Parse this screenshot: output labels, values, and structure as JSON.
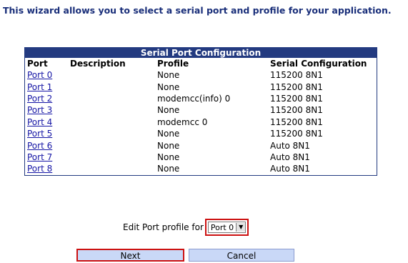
{
  "intro": "This wizard allows you to select a serial port and profile for your application.",
  "table": {
    "caption": "Serial Port Configuration",
    "headers": [
      "Port",
      "Description",
      "Profile",
      "Serial Configuration"
    ],
    "rows": [
      {
        "port": "Port 0",
        "description": "",
        "profile": "None",
        "serial": "115200 8N1"
      },
      {
        "port": "Port 1",
        "description": "",
        "profile": "None",
        "serial": "115200 8N1"
      },
      {
        "port": "Port 2",
        "description": "",
        "profile": "modemcc(info) 0",
        "serial": "115200 8N1"
      },
      {
        "port": "Port 3",
        "description": "",
        "profile": "None",
        "serial": "115200 8N1"
      },
      {
        "port": "Port 4",
        "description": "",
        "profile": "modemcc 0",
        "serial": "115200 8N1"
      },
      {
        "port": "Port 5",
        "description": "",
        "profile": "None",
        "serial": "115200 8N1"
      },
      {
        "port": "Port 6",
        "description": "",
        "profile": "None",
        "serial": "Auto 8N1"
      },
      {
        "port": "Port 7",
        "description": "",
        "profile": "None",
        "serial": "Auto 8N1"
      },
      {
        "port": "Port 8",
        "description": "",
        "profile": "None",
        "serial": "Auto 8N1"
      }
    ]
  },
  "edit": {
    "label": "Edit Port profile for",
    "selected_port": "Port 0"
  },
  "buttons": {
    "next": "Next",
    "cancel": "Cancel"
  },
  "colors": {
    "header_bg": "#233a80",
    "link": "#1515a5",
    "highlight_border": "#cc1111",
    "button_bg": "#c9d8f7"
  }
}
